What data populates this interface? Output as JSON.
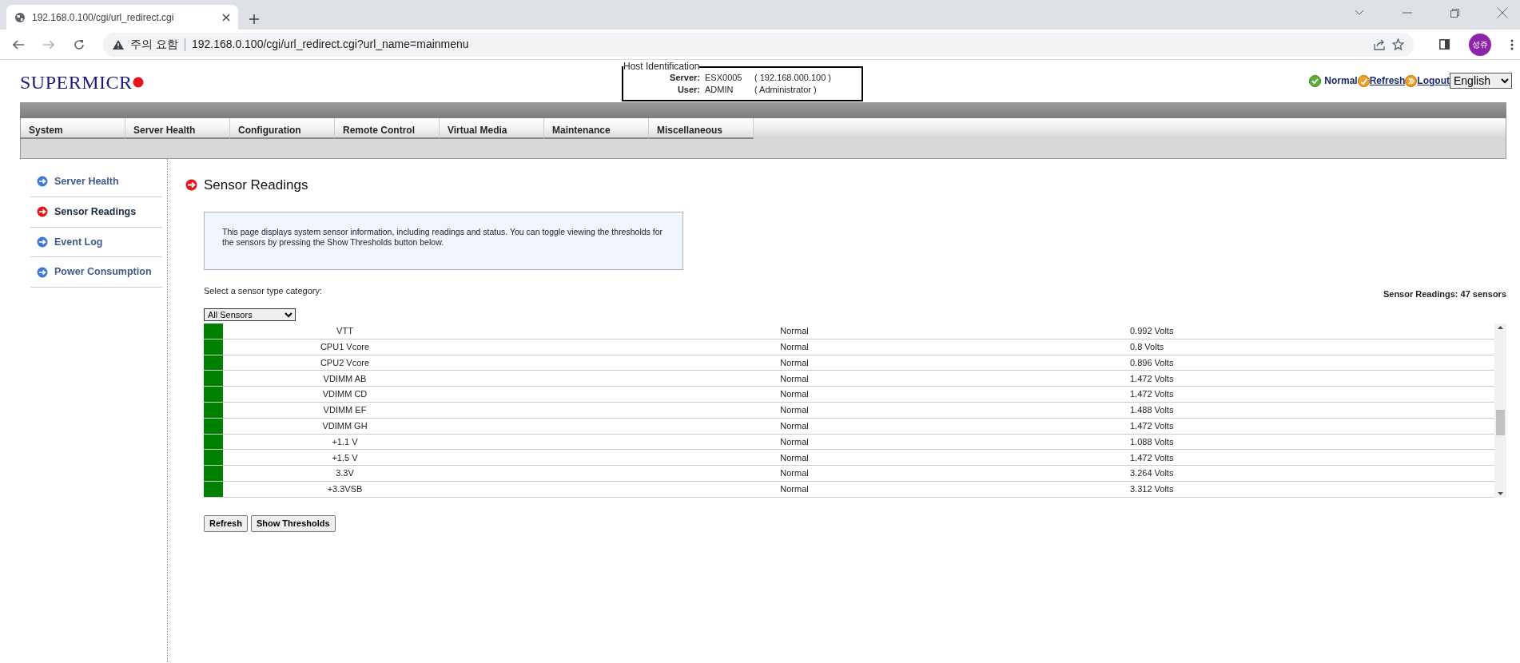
{
  "browser": {
    "tab_title": "192.168.0.100/cgi/url_redirect.cgi",
    "security_warning": "주의 요함",
    "url": "192.168.0.100/cgi/url_redirect.cgi?url_name=mainmenu",
    "profile": "성쥬"
  },
  "header": {
    "logo": "SUPERMICR",
    "host_identification": {
      "legend": "Host Identification",
      "rows": [
        {
          "label": "Server:",
          "value": "ESX0005",
          "detail": "( 192.168.000.100 )"
        },
        {
          "label": "User:",
          "value": "ADMIN",
          "detail": "( Administrator )"
        }
      ]
    },
    "status": "Normal",
    "refresh": "Refresh",
    "logout": "Logout",
    "language": "English"
  },
  "menu": [
    {
      "label": "System"
    },
    {
      "label": "Server Health"
    },
    {
      "label": "Configuration"
    },
    {
      "label": "Remote Control"
    },
    {
      "label": "Virtual Media"
    },
    {
      "label": "Maintenance"
    },
    {
      "label": "Miscellaneous"
    }
  ],
  "sidebar": {
    "items": [
      {
        "label": "Server Health",
        "selected": false
      },
      {
        "label": "Sensor Readings",
        "selected": true
      },
      {
        "label": "Event Log",
        "selected": false
      },
      {
        "label": "Power Consumption",
        "selected": false
      }
    ]
  },
  "content": {
    "title": "Sensor Readings",
    "info": "This page displays system sensor information, including readings and status. You can toggle viewing the thresholds for the sensors by pressing the Show Thresholds button below.",
    "category_label": "Select a sensor type category:",
    "count": "Sensor Readings: 47 sensors",
    "category": "All Sensors",
    "sensors": [
      {
        "name": "VTT",
        "status": "Normal",
        "reading": "0.992 Volts",
        "color": "#008000"
      },
      {
        "name": "CPU1 Vcore",
        "status": "Normal",
        "reading": "0.8 Volts",
        "color": "#008000"
      },
      {
        "name": "CPU2 Vcore",
        "status": "Normal",
        "reading": "0.896 Volts",
        "color": "#008000"
      },
      {
        "name": "VDIMM AB",
        "status": "Normal",
        "reading": "1.472 Volts",
        "color": "#008000"
      },
      {
        "name": "VDIMM CD",
        "status": "Normal",
        "reading": "1.472 Volts",
        "color": "#008000"
      },
      {
        "name": "VDIMM EF",
        "status": "Normal",
        "reading": "1.488 Volts",
        "color": "#008000"
      },
      {
        "name": "VDIMM GH",
        "status": "Normal",
        "reading": "1.472 Volts",
        "color": "#008000"
      },
      {
        "name": "+1.1 V",
        "status": "Normal",
        "reading": "1.088 Volts",
        "color": "#008000"
      },
      {
        "name": "+1.5 V",
        "status": "Normal",
        "reading": "1.472 Volts",
        "color": "#008000"
      },
      {
        "name": "3.3V",
        "status": "Normal",
        "reading": "3.264 Volts",
        "color": "#008000"
      },
      {
        "name": "+3.3VSB",
        "status": "Normal",
        "reading": "3.312 Volts",
        "color": "#008000"
      }
    ],
    "buttons": [
      "Refresh",
      "Show Thresholds"
    ]
  }
}
